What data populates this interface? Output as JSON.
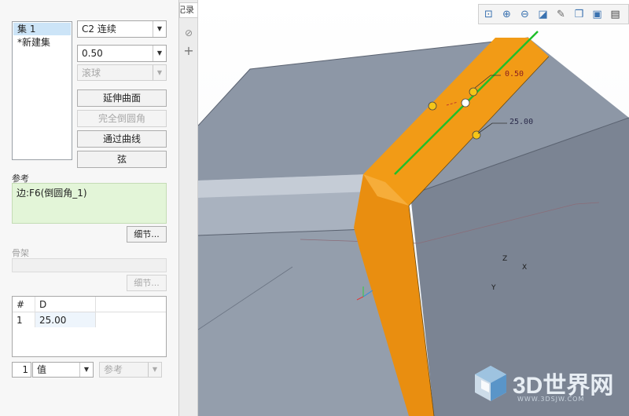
{
  "panel": {
    "sets": {
      "items": [
        "集 1",
        "*新建集"
      ]
    },
    "shape_dropdown": "C2 连续",
    "value_dropdown": "0.50",
    "ball_dropdown": "滚球",
    "buttons": {
      "extend_surface": "延伸曲面",
      "full_round": "完全倒圆角",
      "through_curve": "通过曲线",
      "chord": "弦"
    },
    "references": {
      "label": "参考",
      "value": "边:F6(倒圆角_1)",
      "details": "细节..."
    },
    "spine": {
      "label": "骨架",
      "details": "细节..."
    },
    "radius_table": {
      "headers": [
        "#",
        "D"
      ],
      "rows": [
        {
          "num": "1",
          "d": "25.00"
        }
      ]
    },
    "footer": {
      "index": "1",
      "value_type": "值",
      "ref_type": "参考"
    }
  },
  "splitter": {
    "tab_label": "记录"
  },
  "viewport": {
    "annotations": {
      "value1": "0.50",
      "value2": "25.00"
    },
    "axes": {
      "x": "X",
      "y": "Y",
      "z": "Z"
    },
    "watermark": {
      "brand": "3D世界网",
      "url": "WWW.3DSJW.COM"
    }
  },
  "toolbar": {
    "icons": [
      "zoom-fit-icon",
      "zoom-in-icon",
      "zoom-out-icon",
      "repaint-icon",
      "view-orientation-icon",
      "display-style-icon",
      "saved-views-icon",
      "view-manager-icon"
    ]
  },
  "colors": {
    "fillet": "#f29b16",
    "body_top": "#8b95a5",
    "body_side": "#7a8392",
    "selection_line": "#1fbf2a"
  }
}
